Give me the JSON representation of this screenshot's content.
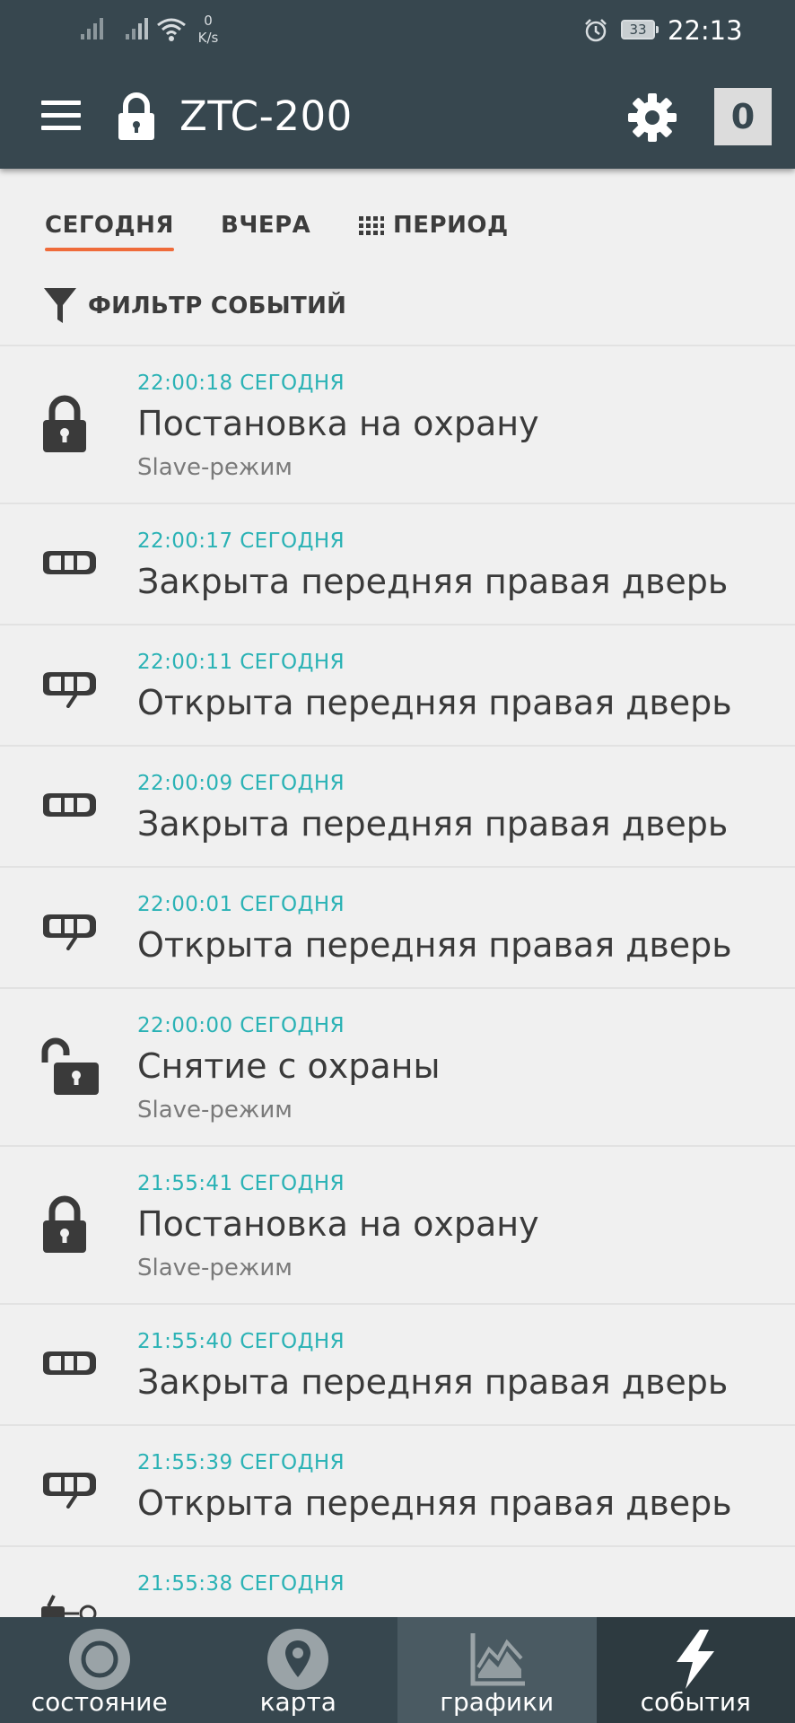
{
  "status_bar": {
    "speed_value": "0",
    "speed_unit": "K/s",
    "battery_level": "33",
    "time": "22:13"
  },
  "toolbar": {
    "title": "ZTC-200",
    "badge_count": "0"
  },
  "tabs": [
    {
      "label": "СЕГОДНЯ",
      "active": true
    },
    {
      "label": "ВЧЕРА",
      "active": false
    },
    {
      "label": "ПЕРИОД",
      "active": false
    }
  ],
  "filter": {
    "label": "ФИЛЬТР СОБЫТИЙ"
  },
  "events": [
    {
      "time": "22:00:18 СЕГОДНЯ",
      "title": "Постановка на охрану",
      "subtitle": "Slave-режим",
      "icon": "lock-closed-icon"
    },
    {
      "time": "22:00:17 СЕГОДНЯ",
      "title": "Закрыта передняя правая дверь",
      "subtitle": "",
      "icon": "car-door-closed-icon"
    },
    {
      "time": "22:00:11 СЕГОДНЯ",
      "title": "Открыта передняя правая дверь",
      "subtitle": "",
      "icon": "car-door-open-icon"
    },
    {
      "time": "22:00:09 СЕГОДНЯ",
      "title": "Закрыта передняя правая дверь",
      "subtitle": "",
      "icon": "car-door-closed-icon"
    },
    {
      "time": "22:00:01 СЕГОДНЯ",
      "title": "Открыта передняя правая дверь",
      "subtitle": "",
      "icon": "car-door-open-icon"
    },
    {
      "time": "22:00:00 СЕГОДНЯ",
      "title": "Снятие с охраны",
      "subtitle": "Slave-режим",
      "icon": "lock-open-icon"
    },
    {
      "time": "21:55:41 СЕГОДНЯ",
      "title": "Постановка на охрану",
      "subtitle": "Slave-режим",
      "icon": "lock-closed-icon"
    },
    {
      "time": "21:55:40 СЕГОДНЯ",
      "title": "Закрыта передняя правая дверь",
      "subtitle": "",
      "icon": "car-door-closed-icon"
    },
    {
      "time": "21:55:39 СЕГОДНЯ",
      "title": "Открыта передняя правая дверь",
      "subtitle": "",
      "icon": "car-door-open-icon"
    },
    {
      "time": "21:55:38 СЕГОДНЯ",
      "title": "",
      "subtitle": "",
      "icon": "ignition-key-icon"
    }
  ],
  "bottom_nav": [
    {
      "label": "состояние",
      "icon": "status-circle-icon"
    },
    {
      "label": "карта",
      "icon": "map-pin-icon"
    },
    {
      "label": "графики",
      "icon": "chart-icon"
    },
    {
      "label": "события",
      "icon": "lightning-icon"
    }
  ],
  "colors": {
    "header_bg": "#37474f",
    "accent_teal": "#2ab2b5",
    "tab_indicator": "#ef6b3a",
    "list_bg": "#f0f0f0"
  }
}
